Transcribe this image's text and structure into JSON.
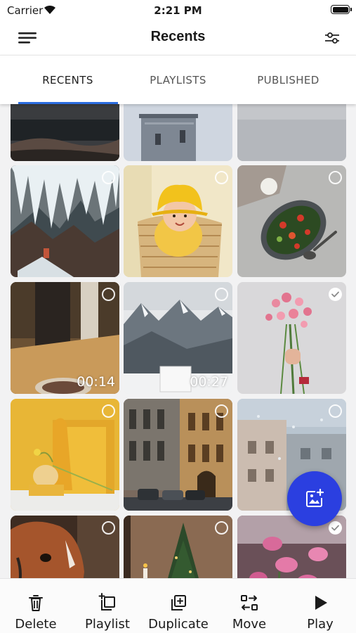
{
  "status_bar": {
    "carrier": "Carrier",
    "time": "2:21 PM"
  },
  "header": {
    "title": "Recents"
  },
  "tabs": [
    {
      "label": "RECENTS",
      "active": true
    },
    {
      "label": "PLAYLISTS",
      "active": false
    },
    {
      "label": "PUBLISHED",
      "active": false
    }
  ],
  "grid": {
    "items": [
      {
        "name": "media-rocky-shore",
        "selected": false
      },
      {
        "name": "media-lighthouse",
        "selected": false
      },
      {
        "name": "media-grey-sky",
        "selected": false
      },
      {
        "name": "media-frozen-waterfall",
        "selected": false
      },
      {
        "name": "media-baby-yellow-hat",
        "selected": false
      },
      {
        "name": "media-salad-bowl",
        "selected": false
      },
      {
        "name": "media-table-video",
        "duration": "00:14",
        "selected": false
      },
      {
        "name": "media-mountain-video",
        "duration": "00:27",
        "selected": false
      },
      {
        "name": "media-flower-bouquet",
        "selected": true
      },
      {
        "name": "media-yellow-vase",
        "selected": false
      },
      {
        "name": "media-city-street",
        "selected": false
      },
      {
        "name": "media-rainy-window",
        "selected": false
      },
      {
        "name": "media-horse",
        "selected": false
      },
      {
        "name": "media-christmas-tree",
        "selected": false
      },
      {
        "name": "media-pink-flowers",
        "selected": true
      }
    ]
  },
  "toolbar": {
    "delete_label": "Delete",
    "playlist_label": "Playlist",
    "duplicate_label": "Duplicate",
    "move_label": "Move",
    "play_label": "Play"
  },
  "icons": {
    "menu": "menu-icon",
    "filter": "filter-sliders-icon",
    "add_image": "add-image-icon",
    "delete": "trash-icon",
    "playlist": "add-to-playlist-icon",
    "duplicate": "duplicate-icon",
    "move": "move-icon",
    "play": "play-icon"
  },
  "colors": {
    "accent": "#2b6de0",
    "fab": "#2b3fe0"
  }
}
